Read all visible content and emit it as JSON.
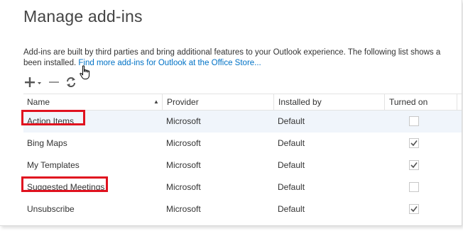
{
  "page": {
    "title": "Manage add-ins",
    "description_line1": "Add-ins are built by third parties and bring additional features to your Outlook experience. The following list shows a",
    "description_line2_prefix": "been installed. ",
    "store_link": "Find more add-ins for Outlook at the Office Store..."
  },
  "toolbar": {
    "add_icon": "plus-icon",
    "dropdown_icon": "caret-down-icon",
    "remove_icon": "minus-icon",
    "refresh_icon": "refresh-icon"
  },
  "table": {
    "columns": [
      "Name",
      "Provider",
      "Installed by",
      "Turned on"
    ],
    "sort_indicator": "▲",
    "rows": [
      {
        "name": "Action Items",
        "provider": "Microsoft",
        "installed_by": "Default",
        "turned_on": false,
        "selected": true,
        "highlighted": true
      },
      {
        "name": "Bing Maps",
        "provider": "Microsoft",
        "installed_by": "Default",
        "turned_on": true,
        "selected": false,
        "highlighted": false
      },
      {
        "name": "My Templates",
        "provider": "Microsoft",
        "installed_by": "Default",
        "turned_on": true,
        "selected": false,
        "highlighted": false
      },
      {
        "name": "Suggested Meetings",
        "provider": "Microsoft",
        "installed_by": "Default",
        "turned_on": false,
        "selected": false,
        "highlighted": true
      },
      {
        "name": "Unsubscribe",
        "provider": "Microsoft",
        "installed_by": "Default",
        "turned_on": true,
        "selected": false,
        "highlighted": false
      }
    ]
  },
  "colors": {
    "link": "#0072c6",
    "highlight_border": "#e0121f",
    "selected_row": "#f0f5fb",
    "check": "#555555"
  }
}
